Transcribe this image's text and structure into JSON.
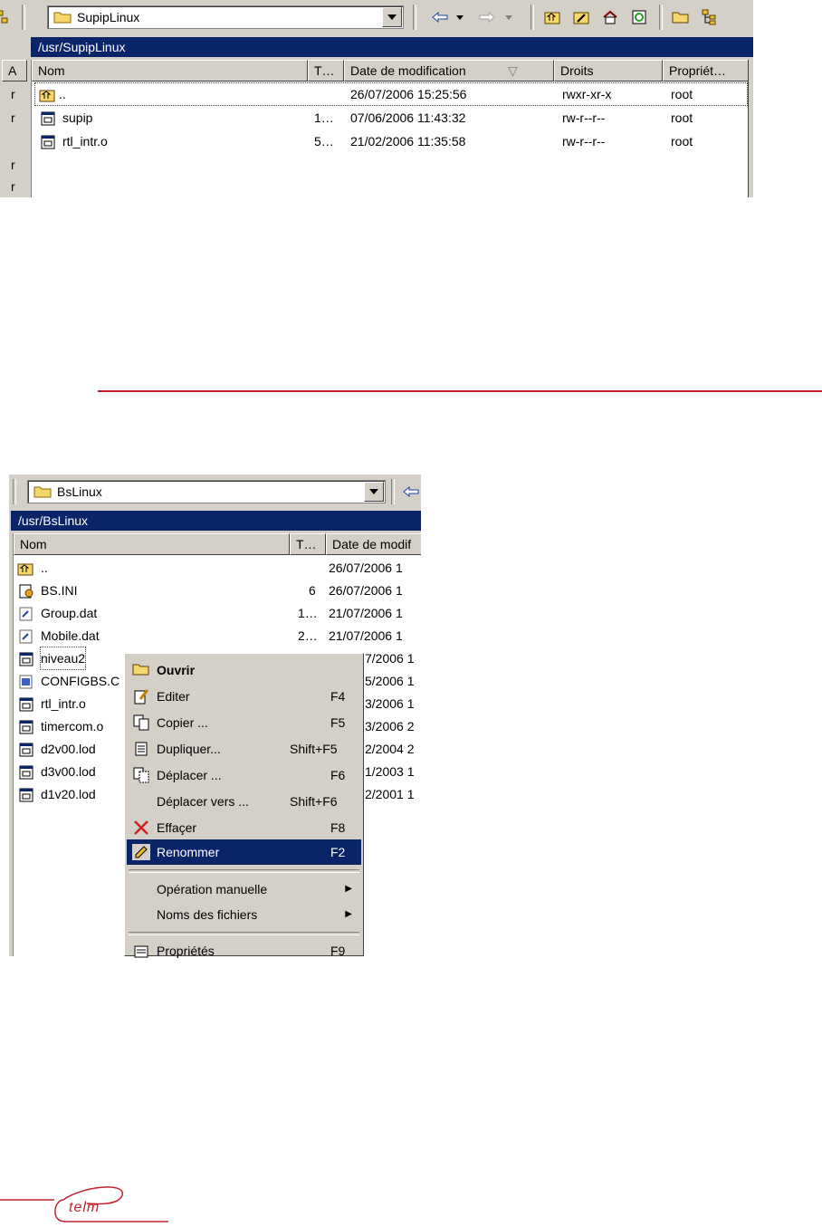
{
  "top": {
    "combo": "SupipLinux",
    "path": "/usr/SupipLinux",
    "columns": [
      "Nom",
      "T…",
      "Date de modification",
      "Droits",
      "Propriét…"
    ],
    "left_col_header": "A",
    "left_letters": [
      "r",
      "r",
      "r",
      "r"
    ],
    "rows": [
      {
        "name": "..",
        "size": "",
        "date": "26/07/2006 15:25:56",
        "rights": "rwxr-xr-x",
        "owner": "root"
      },
      {
        "name": "supip",
        "size": "1…",
        "date": "07/06/2006 11:43:32",
        "rights": "rw-r--r--",
        "owner": "root"
      },
      {
        "name": "rtl_intr.o",
        "size": "5…",
        "date": "21/02/2006 11:35:58",
        "rights": "rw-r--r--",
        "owner": "root"
      }
    ]
  },
  "bottom": {
    "combo": "BsLinux",
    "path": "/usr/BsLinux",
    "columns": [
      "Nom",
      "T…",
      "Date de modif"
    ],
    "rows": [
      {
        "name": "..",
        "size": "",
        "date": "26/07/2006 1"
      },
      {
        "name": "BS.INI",
        "size": "6",
        "date": "26/07/2006 1"
      },
      {
        "name": "Group.dat",
        "size": "1…",
        "date": "21/07/2006 1"
      },
      {
        "name": "Mobile.dat",
        "size": "2…",
        "date": "21/07/2006 1"
      },
      {
        "name": "niveau2",
        "size": "",
        "date": "7/2006 1"
      },
      {
        "name": "CONFIGBS.C",
        "size": "",
        "date": "5/2006 1"
      },
      {
        "name": "rtl_intr.o",
        "size": "",
        "date": "3/2006 1"
      },
      {
        "name": "timercom.o",
        "size": "",
        "date": "3/2006 2"
      },
      {
        "name": "d2v00.lod",
        "size": "",
        "date": "2/2004 2"
      },
      {
        "name": "d3v00.lod",
        "size": "",
        "date": "1/2003 1"
      },
      {
        "name": "d1v20.lod",
        "size": "",
        "date": "2/2001 1"
      }
    ],
    "menu": [
      {
        "label": "Ouvrir",
        "shortcut": ""
      },
      {
        "label": "Editer",
        "shortcut": "F4"
      },
      {
        "label": "Copier ...",
        "shortcut": "F5"
      },
      {
        "label": "Dupliquer...",
        "shortcut": "Shift+F5"
      },
      {
        "label": "Déplacer ...",
        "shortcut": "F6"
      },
      {
        "label": "Déplacer vers ...",
        "shortcut": "Shift+F6"
      },
      {
        "label": "Effaçer",
        "shortcut": "F8"
      },
      {
        "label": "Renommer",
        "shortcut": "F2"
      },
      {
        "label": "Opération manuelle",
        "shortcut": ""
      },
      {
        "label": "Noms des fichiers",
        "shortcut": ""
      },
      {
        "label": "Propriétés",
        "shortcut": "F9"
      }
    ]
  },
  "logo_text": "telm",
  "colors": {
    "selection": "#0a246a",
    "divider": "#c0222e",
    "face": "#d4d0c8"
  }
}
